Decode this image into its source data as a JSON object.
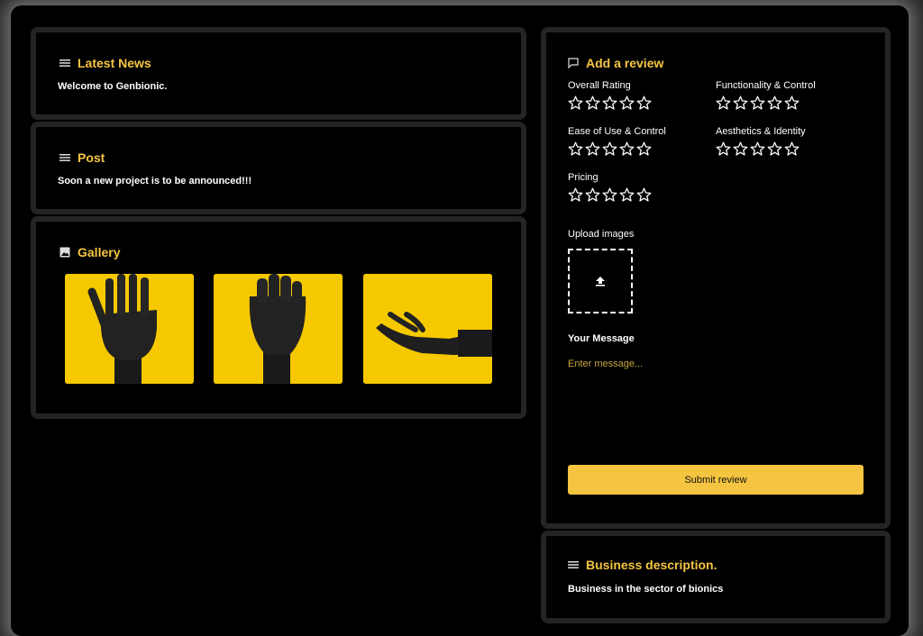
{
  "latest_news": {
    "title": "Latest News",
    "text": "Welcome to Genbionic."
  },
  "post": {
    "title": "Post",
    "text": "Soon a new project is to be announced!!!"
  },
  "gallery": {
    "title": "Gallery",
    "images": [
      "open-hand-icon",
      "fist-icon",
      "reaching-hand-icon"
    ]
  },
  "review": {
    "title": "Add a review",
    "ratings": [
      {
        "label": "Overall Rating",
        "stars": 0,
        "max": 5
      },
      {
        "label": "Functionality & Control",
        "stars": 0,
        "max": 5
      },
      {
        "label": "Ease of Use & Control",
        "stars": 0,
        "max": 5
      },
      {
        "label": "Aesthetics & Identity",
        "stars": 0,
        "max": 5
      },
      {
        "label": "Pricing",
        "stars": 0,
        "max": 5
      }
    ],
    "upload_label": "Upload images",
    "message_label": "Your Message",
    "message_placeholder": "Enter message...",
    "submit_label": "Submit review"
  },
  "business": {
    "title": "Business description.",
    "text": "Business in the sector of bionics"
  },
  "colors": {
    "accent": "#f5c542",
    "background": "#000000",
    "card_border": "#242424",
    "thumb_background": "#f5c800"
  }
}
